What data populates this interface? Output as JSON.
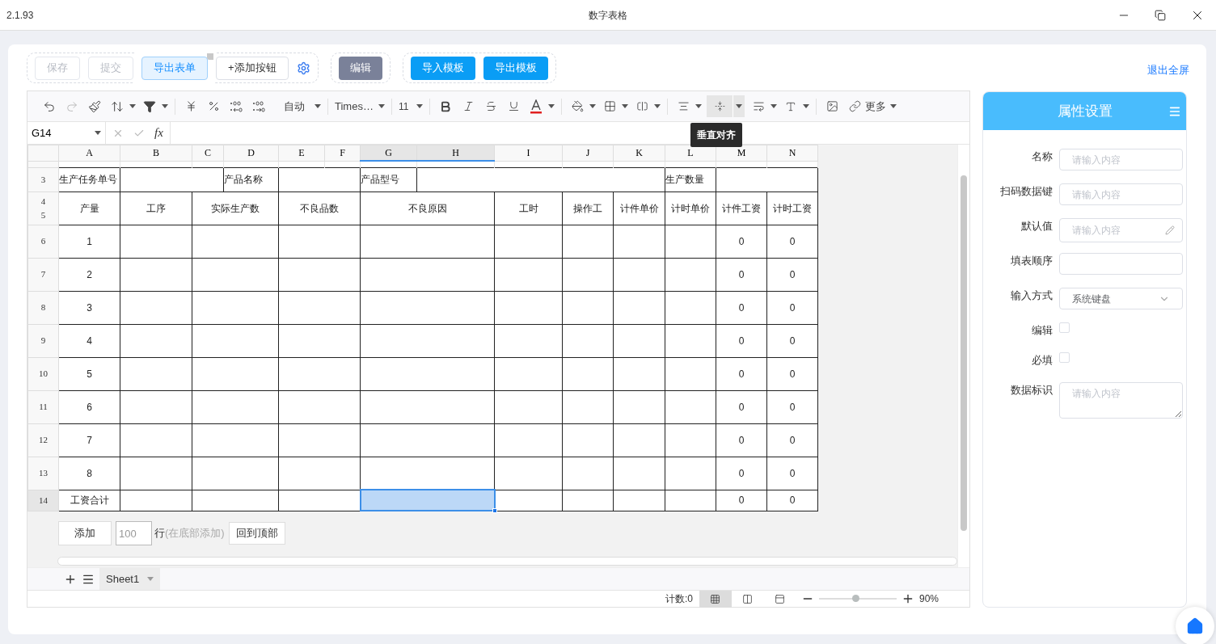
{
  "title_bar": {
    "version": "2.1.93",
    "title": "数字表格"
  },
  "actions": {
    "groups": [
      [
        {
          "label": "保存",
          "kind": "plain",
          "disabled": true
        },
        {
          "label": "提交",
          "kind": "plain",
          "disabled": true
        },
        {
          "label": "导出表单",
          "kind": "light",
          "disabled": false
        },
        {
          "label": "+添加按钮",
          "kind": "plain",
          "disabled": false
        }
      ],
      [
        {
          "label": "编辑",
          "kind": "dark",
          "disabled": false
        }
      ],
      [
        {
          "label": "导入模板",
          "kind": "primary",
          "disabled": false
        },
        {
          "label": "导出模板",
          "kind": "primary",
          "disabled": false
        }
      ]
    ],
    "exit_fullscreen": "退出全屏"
  },
  "sheet": {
    "toolbar": {
      "number_format": "自动",
      "font": "Times…",
      "font_size": "11",
      "more": "更多",
      "vertical_align": {
        "tooltip": "垂直对齐",
        "hovered": true
      }
    },
    "name_box": "G14",
    "function_label": "fx",
    "columns": [
      {
        "label": "A",
        "selected": false
      },
      {
        "label": "B",
        "selected": false
      },
      {
        "label": "C",
        "selected": false
      },
      {
        "label": "D",
        "selected": false
      },
      {
        "label": "E",
        "selected": false
      },
      {
        "label": "F",
        "selected": false
      },
      {
        "label": "G",
        "selected": true
      },
      {
        "label": "H",
        "selected": true
      },
      {
        "label": "I",
        "selected": false
      },
      {
        "label": "J",
        "selected": false
      },
      {
        "label": "K",
        "selected": false
      },
      {
        "label": "L",
        "selected": false
      },
      {
        "label": "M",
        "selected": false
      },
      {
        "label": "N",
        "selected": false
      }
    ],
    "rows": [
      {
        "kind": "info",
        "labels": [
          "3"
        ],
        "selected": false,
        "cells": {
          "A": {
            "text": "生产任务单号",
            "selected": false
          },
          "D": {
            "text": "产品名称",
            "selected": false
          },
          "G": {
            "text": "产品型号",
            "selected": false
          },
          "L": {
            "text": "生产数量",
            "selected": false
          }
        }
      },
      {
        "kind": "header",
        "labels": [
          "4",
          "5"
        ],
        "selected": false,
        "cells": {
          "A": {
            "text": "产量",
            "selected": false
          },
          "B": {
            "text": "工序",
            "selected": false
          },
          "C": {
            "text": "实际生产数",
            "selected": false
          },
          "E": {
            "text": "不良品数",
            "selected": false
          },
          "G": {
            "text": "不良原因",
            "selected": false
          },
          "I": {
            "text": "工时",
            "selected": false
          },
          "J": {
            "text": "操作工",
            "selected": false
          },
          "K": {
            "text": "计件单价",
            "selected": false
          },
          "L": {
            "text": "计时单价",
            "selected": false
          },
          "M": {
            "text": "计件工资",
            "selected": false
          },
          "N": {
            "text": "计时工资",
            "selected": false
          }
        }
      },
      {
        "kind": "data",
        "labels": [
          "6"
        ],
        "selected": false,
        "cells": {
          "A": {
            "text": "1",
            "selected": false
          },
          "M": {
            "text": "0",
            "selected": false
          },
          "N": {
            "text": "0",
            "selected": false
          }
        }
      },
      {
        "kind": "data",
        "labels": [
          "7"
        ],
        "selected": false,
        "cells": {
          "A": {
            "text": "2",
            "selected": false
          },
          "M": {
            "text": "0",
            "selected": false
          },
          "N": {
            "text": "0",
            "selected": false
          }
        }
      },
      {
        "kind": "data",
        "labels": [
          "8"
        ],
        "selected": false,
        "cells": {
          "A": {
            "text": "3",
            "selected": false
          },
          "M": {
            "text": "0",
            "selected": false
          },
          "N": {
            "text": "0",
            "selected": false
          }
        }
      },
      {
        "kind": "data",
        "labels": [
          "9"
        ],
        "selected": false,
        "cells": {
          "A": {
            "text": "4",
            "selected": false
          },
          "M": {
            "text": "0",
            "selected": false
          },
          "N": {
            "text": "0",
            "selected": false
          }
        }
      },
      {
        "kind": "data",
        "labels": [
          "10"
        ],
        "selected": false,
        "cells": {
          "A": {
            "text": "5",
            "selected": false
          },
          "M": {
            "text": "0",
            "selected": false
          },
          "N": {
            "text": "0",
            "selected": false
          }
        }
      },
      {
        "kind": "data",
        "labels": [
          "11"
        ],
        "selected": false,
        "cells": {
          "A": {
            "text": "6",
            "selected": false
          },
          "M": {
            "text": "0",
            "selected": false
          },
          "N": {
            "text": "0",
            "selected": false
          }
        }
      },
      {
        "kind": "data",
        "labels": [
          "12"
        ],
        "selected": false,
        "cells": {
          "A": {
            "text": "7",
            "selected": false
          },
          "M": {
            "text": "0",
            "selected": false
          },
          "N": {
            "text": "0",
            "selected": false
          }
        }
      },
      {
        "kind": "data",
        "labels": [
          "13"
        ],
        "selected": false,
        "cells": {
          "A": {
            "text": "8",
            "selected": false
          },
          "M": {
            "text": "0",
            "selected": false
          },
          "N": {
            "text": "0",
            "selected": false
          }
        }
      },
      {
        "kind": "total",
        "labels": [
          "14"
        ],
        "selected": true,
        "cells": {
          "A": {
            "text": "工资合计",
            "selected": false
          },
          "G": {
            "selected": true
          },
          "M": {
            "text": "0",
            "selected": false
          },
          "N": {
            "text": "0",
            "selected": false
          }
        }
      }
    ],
    "add_rows": {
      "button": "添加",
      "count": "100",
      "unit": "行",
      "hint": "(在底部添加)",
      "top_button": "回到顶部"
    },
    "tabs": [
      {
        "label": "Sheet1",
        "selected": true
      }
    ],
    "status": {
      "count": "计数:0",
      "views": [
        {
          "kind": "normal",
          "selected": true
        },
        {
          "kind": "page_break",
          "selected": false
        },
        {
          "kind": "page_layout",
          "selected": false
        }
      ],
      "zoom": {
        "level": 0.47,
        "reading": "90%"
      }
    }
  },
  "panel": {
    "title": "属性设置",
    "fields": [
      {
        "label": "名称",
        "kind": "text",
        "placeholder": "请输入内容"
      },
      {
        "label": "扫码数据键",
        "kind": "text",
        "placeholder": "请输入内容"
      },
      {
        "label": "默认值",
        "kind": "edit",
        "placeholder": "请输入内容"
      },
      {
        "label": "填表顺序",
        "kind": "text"
      },
      {
        "label": "输入方式",
        "kind": "select",
        "value": "系统键盘"
      },
      {
        "label": "编辑",
        "kind": "checkbox",
        "checked": false
      },
      {
        "label": "必填",
        "kind": "checkbox",
        "checked": false
      },
      {
        "label": "数据标识",
        "kind": "textarea",
        "placeholder": "请输入内容"
      }
    ]
  }
}
